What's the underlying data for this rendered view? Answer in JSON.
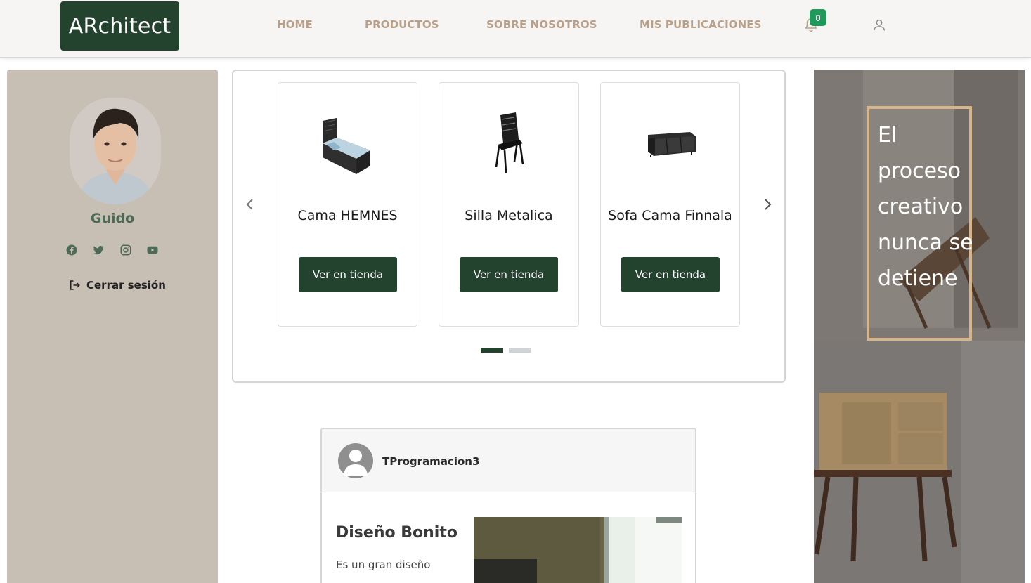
{
  "header": {
    "logo": "ARchitect",
    "nav": [
      "HOME",
      "PRODUCTOS",
      "SOBRE NOSOTROS",
      "MIS PUBLICACIONES"
    ],
    "notification_count": "0",
    "accent_color": "#23432f",
    "nav_color": "#b8a08a",
    "badge_color": "#1f9a5b"
  },
  "sidebar": {
    "user_name": "Guido",
    "social_icons": [
      "facebook-icon",
      "twitter-icon",
      "instagram-icon",
      "youtube-icon"
    ],
    "logout_label": "Cerrar sesión",
    "background": "#c7beb4"
  },
  "carousel": {
    "cards": [
      {
        "title": "Cama HEMNES",
        "button": "Ver en tienda",
        "icon": "bed-icon"
      },
      {
        "title": "Silla Metalica",
        "button": "Ver en tienda",
        "icon": "chair-icon"
      },
      {
        "title": "Sofa Cama Finnala",
        "button": "Ver en tienda",
        "icon": "sofa-icon"
      }
    ],
    "active_indicator": 1,
    "indicator_count": 2
  },
  "post": {
    "user": "TProgramacion3",
    "title": "Diseño Bonito",
    "text": "Es un gran diseño"
  },
  "quote": {
    "text": "El proceso creativo nunca se detiene",
    "border_color": "#d6b58a"
  }
}
